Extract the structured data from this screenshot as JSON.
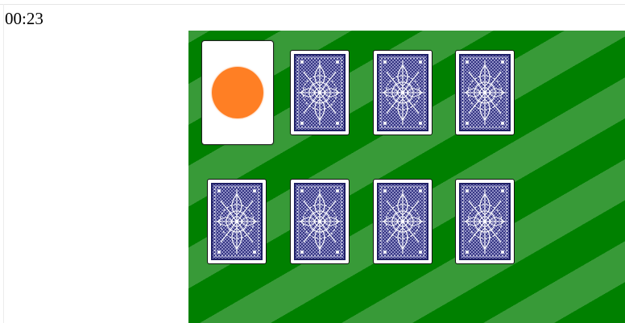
{
  "timer": {
    "text": "00:23"
  },
  "board": {
    "colors": {
      "felt": "#008000",
      "stripe": "#389a38"
    },
    "cards": [
      {
        "state": "face-up",
        "symbol": "orange-circle",
        "color": "#ff7f24"
      },
      {
        "state": "face-down"
      },
      {
        "state": "face-down"
      },
      {
        "state": "face-down"
      },
      {
        "state": "face-down"
      },
      {
        "state": "face-down"
      },
      {
        "state": "face-down"
      },
      {
        "state": "face-down"
      }
    ],
    "card_back": {
      "frame_color": "#1f1f66",
      "pattern_color": "#ffffff"
    }
  }
}
